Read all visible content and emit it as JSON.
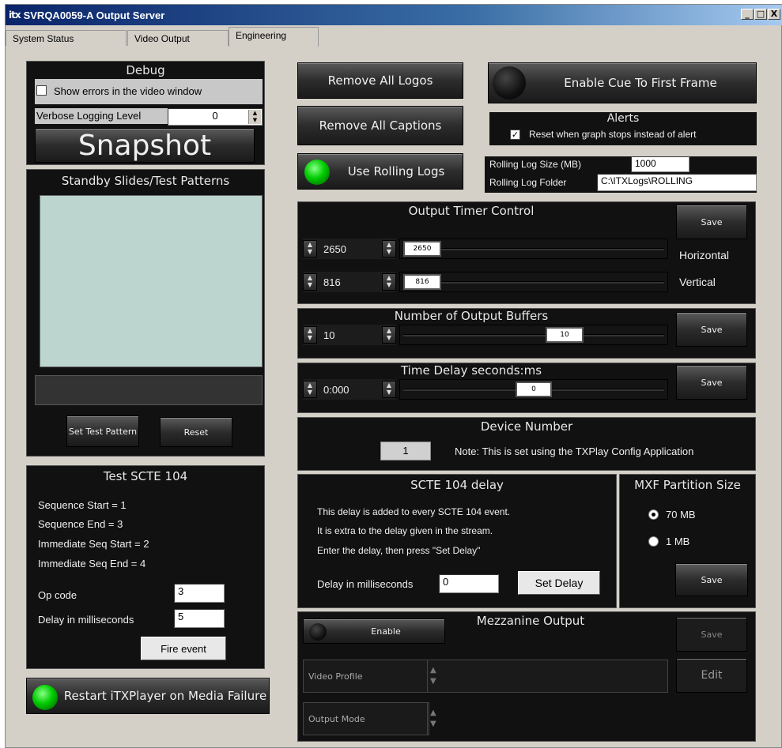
{
  "window": {
    "logo": "itx",
    "title": "SVRQA0059-A Output Server",
    "minimize": "_",
    "maximize": "□",
    "close": "X"
  },
  "tabs": [
    {
      "label": "System Status"
    },
    {
      "label": "Video Output"
    },
    {
      "label": "Engineering"
    }
  ],
  "debug": {
    "title": "Debug",
    "show_errors_label": "Show errors in the video window",
    "show_errors_checked": false,
    "verbose_label": "Verbose Logging Level",
    "verbose_value": "0",
    "snapshot_label": "Snapshot"
  },
  "standby": {
    "title": "Standby Slides/Test Patterns",
    "set_test_pattern": "Set Test Pattern",
    "reset": "Reset"
  },
  "scte_test": {
    "title": "Test SCTE 104",
    "lines": [
      "Sequence Start = 1",
      "Sequence End = 3",
      "Immediate Seq Start = 2",
      "Immediate Seq End = 4"
    ],
    "op_code_label": "Op code",
    "op_code_value": "3",
    "delay_label": "Delay in milliseconds",
    "delay_value": "5",
    "fire_event": "Fire event"
  },
  "restart": {
    "label": "Restart iTXPlayer on Media Failure"
  },
  "top_buttons": {
    "remove_logos": "Remove All Logos",
    "remove_captions": "Remove All Captions",
    "use_rolling_logs": "Use Rolling Logs",
    "enable_cue": "Enable Cue To First Frame"
  },
  "alerts": {
    "title": "Alerts",
    "reset_label": "Reset when graph stops instead of alert",
    "reset_checked": true
  },
  "rolling": {
    "size_label": "Rolling Log Size (MB)",
    "size_value": "1000",
    "folder_label": "Rolling Log Folder",
    "folder_value": "C:\\ITXLogs\\ROLLING"
  },
  "timer": {
    "title": "Output Timer Control",
    "save": "Save",
    "horizontal_value": "2650",
    "horizontal_thumb": "2650",
    "horizontal_label": "Horizontal",
    "vertical_value": "816",
    "vertical_thumb": "816",
    "vertical_label": "Vertical"
  },
  "buffers": {
    "title": "Number of Output Buffers",
    "value": "10",
    "thumb": "10",
    "save": "Save"
  },
  "time_delay": {
    "title": "Time Delay seconds:ms",
    "value": "0:000",
    "thumb": "0",
    "save": "Save"
  },
  "device": {
    "title": "Device Number",
    "value": "1",
    "note": "Note: This is set using the TXPlay Config Application"
  },
  "scte_delay": {
    "title": "SCTE 104 delay",
    "lines": [
      "This delay is added to every SCTE 104 event.",
      "It is extra to the delay given in the stream.",
      "Enter the delay, then press \"Set Delay\""
    ],
    "delay_label": "Delay in milliseconds",
    "delay_value": "0",
    "set_delay": "Set Delay"
  },
  "mxf": {
    "title": "MXF Partition Size",
    "opt1": "70 MB",
    "opt2": "1 MB",
    "selected": "70 MB",
    "save": "Save"
  },
  "mezzanine": {
    "title": "Mezzanine Output",
    "enable": "Enable",
    "save": "Save",
    "edit": "Edit",
    "video_profile": "Video Profile",
    "output_mode": "Output Mode"
  },
  "colors": {
    "panel_bg": "#111111",
    "accent_green": "#00cc00",
    "window_bg": "#d4d0c8"
  }
}
